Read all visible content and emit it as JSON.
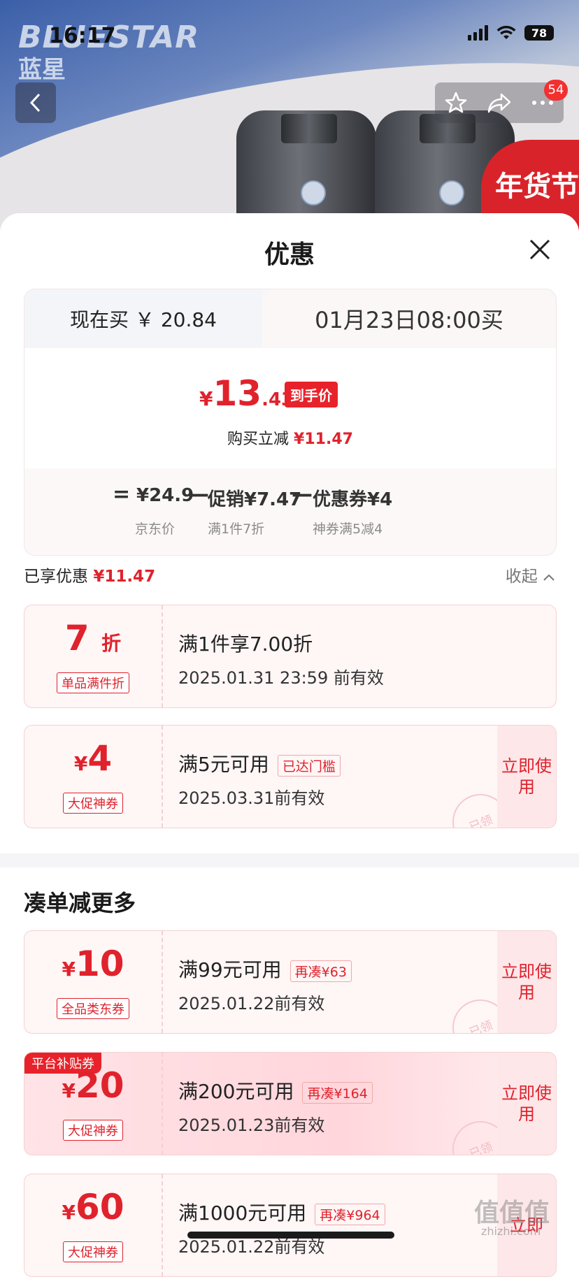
{
  "status_bar": {
    "time": "16:17",
    "battery": "78"
  },
  "hero": {
    "brand_en": "BLUESTAR",
    "brand_cn": "蓝星",
    "cart_badge": "54",
    "festival": "年货节"
  },
  "sheet": {
    "title": "优惠"
  },
  "tabs": {
    "now": "现在买 ￥ 20.84",
    "later": "01月23日08:00买"
  },
  "price": {
    "symbol": "¥",
    "int": "13",
    "dec": ".43",
    "tag": "到手价",
    "save_label": "购买立减",
    "save_value": "¥11.47"
  },
  "breakdown": {
    "eq": "=",
    "jd_price": "¥24.9",
    "jd_label": "京东价",
    "minus1": "—",
    "promo": "促销¥7.47",
    "promo_label": "满1件7折",
    "minus2": "—",
    "coupon": "优惠券¥4",
    "coupon_label": "神券满5减4"
  },
  "enjoyed": {
    "label": "已享优惠",
    "value": "¥11.47",
    "collapse": "收起"
  },
  "coupons": [
    {
      "value": "7",
      "unit": "折",
      "tag": "单品满件折",
      "title": "满1件享7.00折",
      "note": "",
      "date": "2025.01.31 23:59 前有效",
      "action": "",
      "stamp": ""
    },
    {
      "sym": "¥",
      "value": "4",
      "tag": "大促神券",
      "title": "满5元可用",
      "note": "已达门槛",
      "date": "2025.03.31前有效",
      "action": "立即使用",
      "stamp": "已领"
    }
  ],
  "more": {
    "title": "凑单减更多",
    "coupons": [
      {
        "sym": "¥",
        "value": "10",
        "tag": "全品类东券",
        "title": "满99元可用",
        "note": "再凑¥63",
        "date": "2025.01.22前有效",
        "action": "立即使用",
        "stamp": "已领",
        "platform": ""
      },
      {
        "sym": "¥",
        "value": "20",
        "tag": "大促神券",
        "title": "满200元可用",
        "note": "再凑¥164",
        "date": "2025.01.23前有效",
        "action": "立即使用",
        "stamp": "已领",
        "platform": "平台补贴券"
      },
      {
        "sym": "¥",
        "value": "60",
        "tag": "大促神券",
        "title": "满1000元可用",
        "note": "再凑¥964",
        "date": "2025.01.22前有效",
        "action": "立即",
        "stamp": "",
        "platform": ""
      }
    ]
  },
  "watermark": {
    "logo": "值值值",
    "site": "zhizhi.com"
  }
}
